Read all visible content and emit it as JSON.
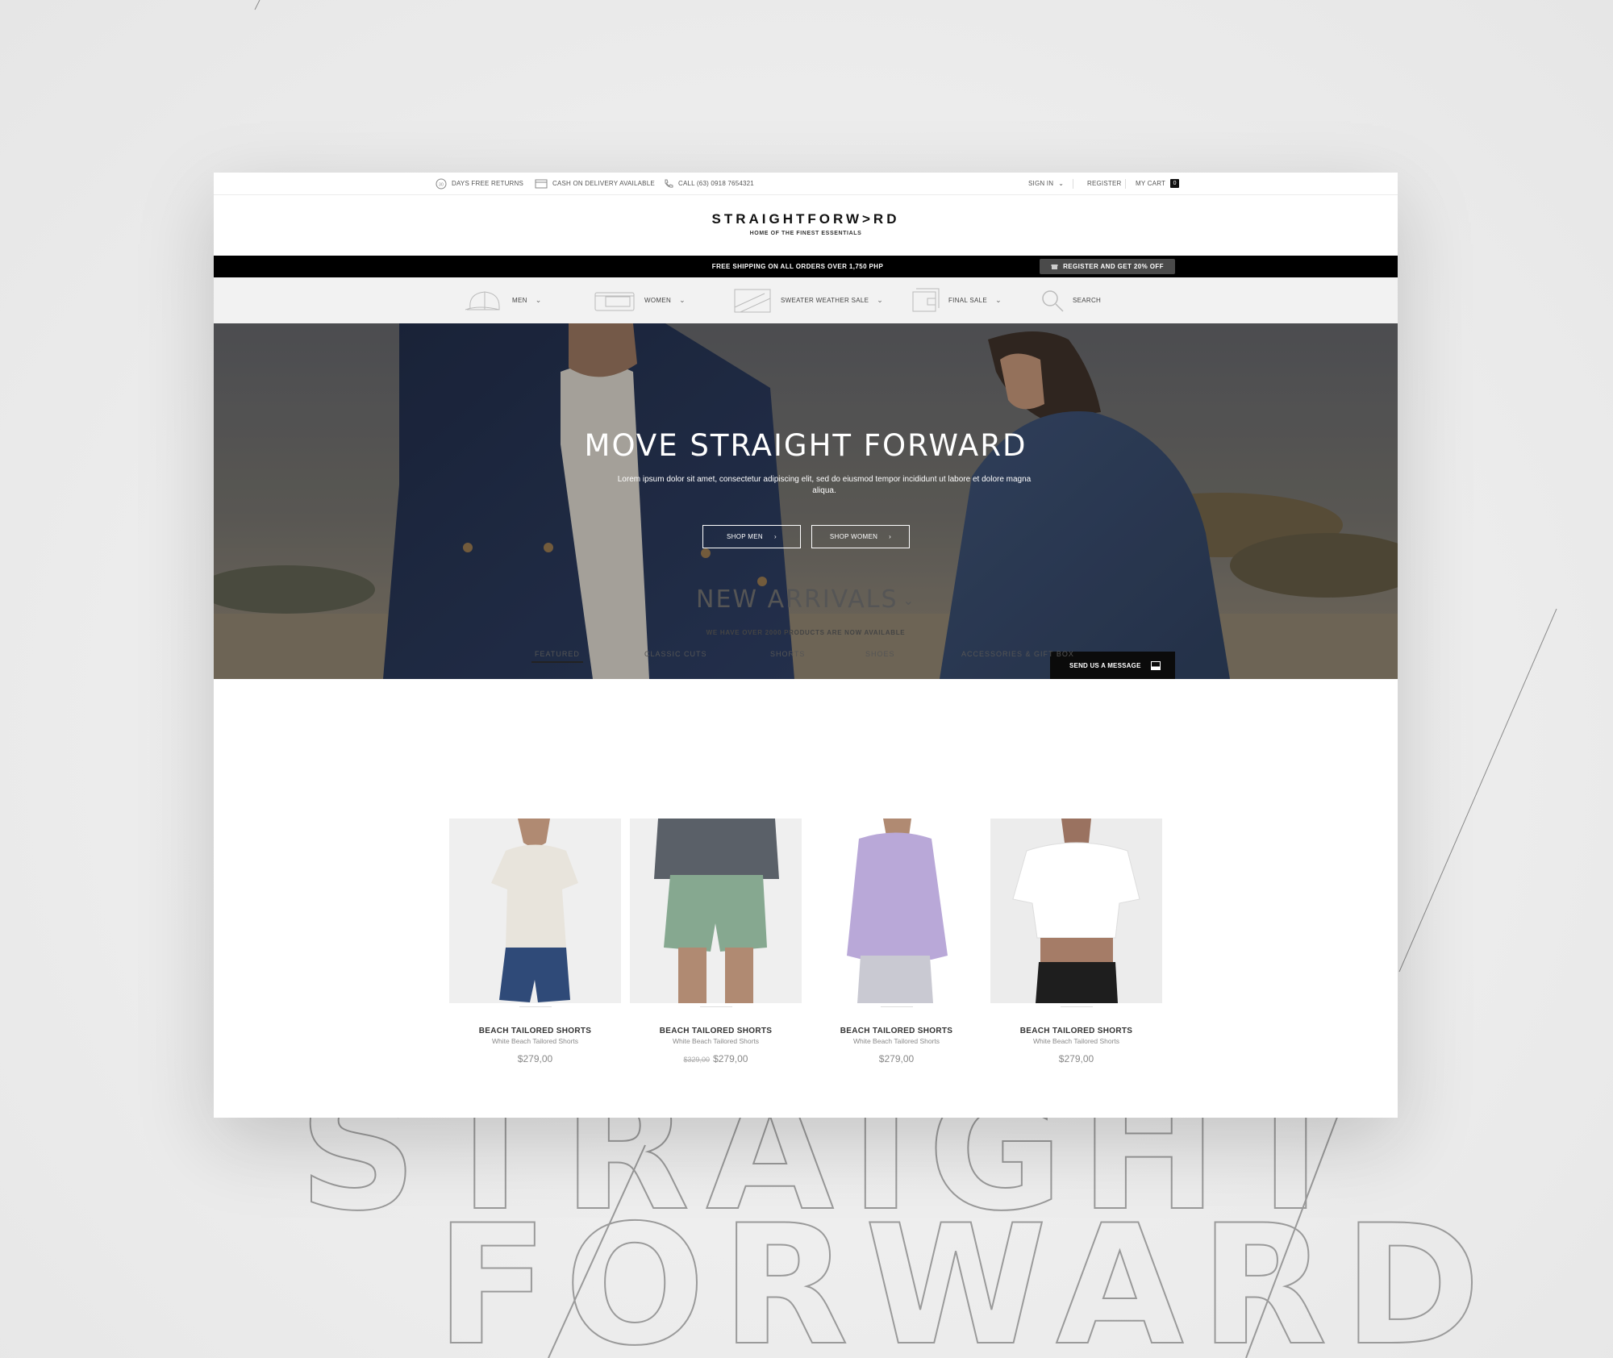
{
  "utility": {
    "returns": "DAYS FREE RETURNS",
    "returns_badge": "30",
    "cod": "CASH ON DELIVERY AVAILABLE",
    "phone": "CALL (63) 0918 7654321",
    "sign_in": "SIGN IN",
    "register": "REGISTER",
    "cart": "MY CART",
    "cart_count": "0"
  },
  "brand": {
    "logo": "STRAIGHTFORW>RD",
    "tagline": "HOME OF THE FINEST ESSENTIALS"
  },
  "promo": {
    "text": "FREE SHIPPING ON ALL ORDERS OVER 1,750 PHP",
    "button": "REGISTER AND GET 20% OFF"
  },
  "nav": {
    "items": [
      {
        "label": "MEN",
        "icon": "cap-icon"
      },
      {
        "label": "WOMEN",
        "icon": "wallet-icon"
      },
      {
        "label": "SWEATER WEATHER SALE",
        "icon": "bag-icon"
      },
      {
        "label": "FINAL SALE",
        "icon": "card-icon"
      },
      {
        "label": "SEARCH",
        "icon": "search-icon"
      }
    ]
  },
  "hero": {
    "title": "MOVE STRAIGHT FORWARD",
    "subtitle": "Lorem ipsum dolor sit amet, consectetur adipiscing elit, sed do eiusmod tempor incididunt ut labore et dolore magna aliqua.",
    "shop_men": "SHOP MEN",
    "shop_women": "SHOP WOMEN",
    "message": "SEND US A MESSAGE"
  },
  "arrivals": {
    "title": "NEW ARRIVALS",
    "subtitle": "WE HAVE OVER 2000 PRODUCTS ARE NOW AVAILABLE",
    "tabs": [
      "FEATURED",
      "CLASSIC CUTS",
      "SHORTS",
      "SHOES",
      "ACCESSORIES & GIFT BOX"
    ],
    "products": [
      {
        "name": "BEACH TAILORED SHORTS",
        "desc": "White Beach Tailored Shorts",
        "old_price": "",
        "price": "$279,00"
      },
      {
        "name": "BEACH TAILORED SHORTS",
        "desc": "White Beach Tailored Shorts",
        "old_price": "$329,00",
        "price": "$279,00"
      },
      {
        "name": "BEACH TAILORED SHORTS",
        "desc": "White Beach Tailored Shorts",
        "old_price": "",
        "price": "$279,00"
      },
      {
        "name": "BEACH TAILORED SHORTS",
        "desc": "White Beach Tailored Shorts",
        "old_price": "",
        "price": "$279,00"
      }
    ]
  },
  "background": {
    "word1": "STRAIGHT",
    "word2": "FORWARD"
  }
}
